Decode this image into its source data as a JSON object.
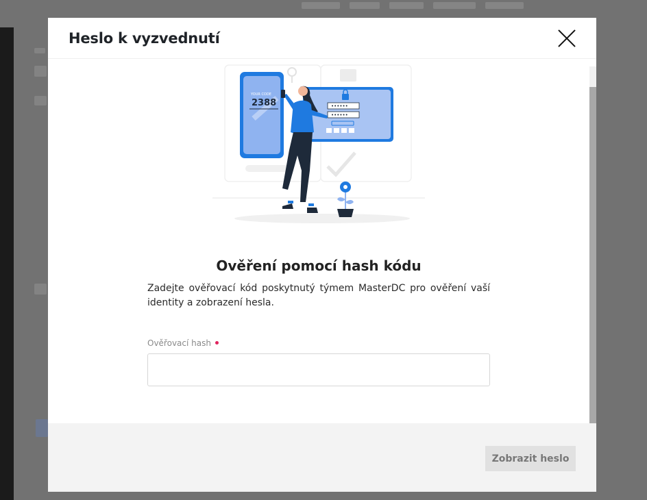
{
  "modal": {
    "title": "Heslo k vyzvednutí",
    "close_icon": "close-icon"
  },
  "illustration": {
    "code_label": "YOUR CODE",
    "code_value": "2388",
    "password_mask_1": "••••••",
    "password_mask_2": "••••••"
  },
  "content": {
    "heading": "Ověření pomocí hash kódu",
    "description": "Zadejte ověřovací kód poskytnutý týmem MasterDC pro ověření vaší identity a zobrazení hesla.",
    "field_label": "Ověřovací hash",
    "field_value": "",
    "field_placeholder": ""
  },
  "footer": {
    "submit_label": "Zobrazit heslo"
  },
  "colors": {
    "accent_blue": "#1f7ae0",
    "required": "#e0245e",
    "button_disabled_bg": "#e1e1e1"
  }
}
